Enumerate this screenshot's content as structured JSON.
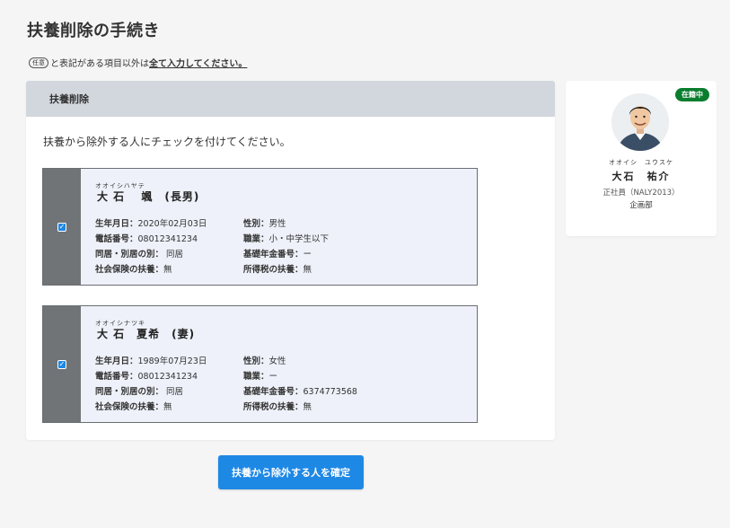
{
  "page": {
    "title": "扶養削除の手続き",
    "note_badge": "任意",
    "note_text": "と表記がある項目以外は",
    "note_emphasis": "全て入力してください。"
  },
  "panel": {
    "header": "扶養削除",
    "instruction": "扶養から除外する人にチェックを付けてください。"
  },
  "dependents": [
    {
      "checked": true,
      "kana": "オオイシハヤテ",
      "name": "大 石　 颯　(長男)",
      "fields": [
        [
          {
            "label": "生年月日：",
            "value": "2020年02月03日"
          },
          {
            "label": "性別：",
            "value": "男性"
          }
        ],
        [
          {
            "label": "電話番号：",
            "value": "08012341234"
          },
          {
            "label": "職業：",
            "value": "小・中学生以下"
          }
        ],
        [
          {
            "label": "同居・別居の別：",
            "value": " 同居"
          },
          {
            "label": "基礎年金番号：",
            "value": "ー"
          }
        ],
        [
          {
            "label": "社会保険の扶養：",
            "value": "無"
          },
          {
            "label": "所得税の扶養：",
            "value": "無"
          }
        ]
      ]
    },
    {
      "checked": true,
      "kana": "オオイシナツキ",
      "name": "大 石　夏希　(妻)",
      "fields": [
        [
          {
            "label": "生年月日：",
            "value": "1989年07月23日"
          },
          {
            "label": "性別：",
            "value": "女性"
          }
        ],
        [
          {
            "label": "電話番号：",
            "value": "08012341234"
          },
          {
            "label": "職業：",
            "value": "ー"
          }
        ],
        [
          {
            "label": "同居・別居の別：",
            "value": " 同居"
          },
          {
            "label": "基礎年金番号：",
            "value": "6374773568"
          }
        ],
        [
          {
            "label": "社会保険の扶養：",
            "value": "無"
          },
          {
            "label": "所得税の扶養：",
            "value": "無"
          }
        ]
      ]
    }
  ],
  "confirm_button": "扶養から除外する人を確定",
  "employee": {
    "status": "在籍中",
    "kana": "オオイシ　ユウスケ",
    "name": "大石　祐介",
    "position": "正社員（NALY2013）",
    "department": "企画部"
  },
  "colors": {
    "accent": "#1e88e5",
    "status": "#0a7d2e",
    "panel_header": "#d2d7dd",
    "card_bg": "#eef1f9",
    "check_column": "#707477"
  },
  "icons": {
    "checkbox": "checkbox-checked-icon",
    "avatar": "avatar-photo"
  }
}
